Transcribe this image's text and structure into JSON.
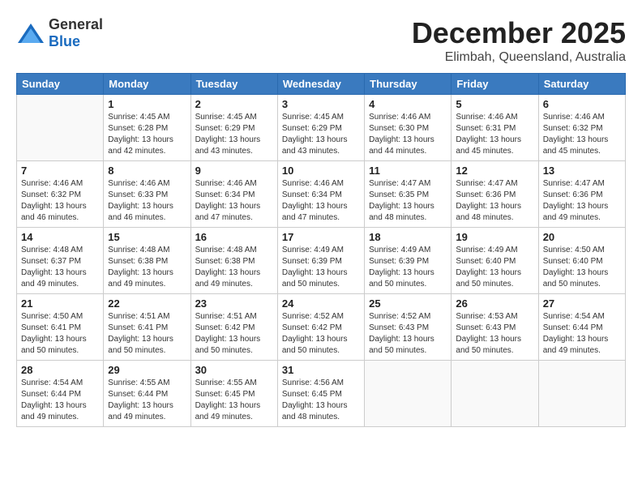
{
  "logo": {
    "general": "General",
    "blue": "Blue"
  },
  "title": "December 2025",
  "location": "Elimbah, Queensland, Australia",
  "days_of_week": [
    "Sunday",
    "Monday",
    "Tuesday",
    "Wednesday",
    "Thursday",
    "Friday",
    "Saturday"
  ],
  "weeks": [
    [
      {
        "day": "",
        "info": ""
      },
      {
        "day": "1",
        "info": "Sunrise: 4:45 AM\nSunset: 6:28 PM\nDaylight: 13 hours\nand 42 minutes."
      },
      {
        "day": "2",
        "info": "Sunrise: 4:45 AM\nSunset: 6:29 PM\nDaylight: 13 hours\nand 43 minutes."
      },
      {
        "day": "3",
        "info": "Sunrise: 4:45 AM\nSunset: 6:29 PM\nDaylight: 13 hours\nand 43 minutes."
      },
      {
        "day": "4",
        "info": "Sunrise: 4:46 AM\nSunset: 6:30 PM\nDaylight: 13 hours\nand 44 minutes."
      },
      {
        "day": "5",
        "info": "Sunrise: 4:46 AM\nSunset: 6:31 PM\nDaylight: 13 hours\nand 45 minutes."
      },
      {
        "day": "6",
        "info": "Sunrise: 4:46 AM\nSunset: 6:32 PM\nDaylight: 13 hours\nand 45 minutes."
      }
    ],
    [
      {
        "day": "7",
        "info": "Sunrise: 4:46 AM\nSunset: 6:32 PM\nDaylight: 13 hours\nand 46 minutes."
      },
      {
        "day": "8",
        "info": "Sunrise: 4:46 AM\nSunset: 6:33 PM\nDaylight: 13 hours\nand 46 minutes."
      },
      {
        "day": "9",
        "info": "Sunrise: 4:46 AM\nSunset: 6:34 PM\nDaylight: 13 hours\nand 47 minutes."
      },
      {
        "day": "10",
        "info": "Sunrise: 4:46 AM\nSunset: 6:34 PM\nDaylight: 13 hours\nand 47 minutes."
      },
      {
        "day": "11",
        "info": "Sunrise: 4:47 AM\nSunset: 6:35 PM\nDaylight: 13 hours\nand 48 minutes."
      },
      {
        "day": "12",
        "info": "Sunrise: 4:47 AM\nSunset: 6:36 PM\nDaylight: 13 hours\nand 48 minutes."
      },
      {
        "day": "13",
        "info": "Sunrise: 4:47 AM\nSunset: 6:36 PM\nDaylight: 13 hours\nand 49 minutes."
      }
    ],
    [
      {
        "day": "14",
        "info": "Sunrise: 4:48 AM\nSunset: 6:37 PM\nDaylight: 13 hours\nand 49 minutes."
      },
      {
        "day": "15",
        "info": "Sunrise: 4:48 AM\nSunset: 6:38 PM\nDaylight: 13 hours\nand 49 minutes."
      },
      {
        "day": "16",
        "info": "Sunrise: 4:48 AM\nSunset: 6:38 PM\nDaylight: 13 hours\nand 49 minutes."
      },
      {
        "day": "17",
        "info": "Sunrise: 4:49 AM\nSunset: 6:39 PM\nDaylight: 13 hours\nand 50 minutes."
      },
      {
        "day": "18",
        "info": "Sunrise: 4:49 AM\nSunset: 6:39 PM\nDaylight: 13 hours\nand 50 minutes."
      },
      {
        "day": "19",
        "info": "Sunrise: 4:49 AM\nSunset: 6:40 PM\nDaylight: 13 hours\nand 50 minutes."
      },
      {
        "day": "20",
        "info": "Sunrise: 4:50 AM\nSunset: 6:40 PM\nDaylight: 13 hours\nand 50 minutes."
      }
    ],
    [
      {
        "day": "21",
        "info": "Sunrise: 4:50 AM\nSunset: 6:41 PM\nDaylight: 13 hours\nand 50 minutes."
      },
      {
        "day": "22",
        "info": "Sunrise: 4:51 AM\nSunset: 6:41 PM\nDaylight: 13 hours\nand 50 minutes."
      },
      {
        "day": "23",
        "info": "Sunrise: 4:51 AM\nSunset: 6:42 PM\nDaylight: 13 hours\nand 50 minutes."
      },
      {
        "day": "24",
        "info": "Sunrise: 4:52 AM\nSunset: 6:42 PM\nDaylight: 13 hours\nand 50 minutes."
      },
      {
        "day": "25",
        "info": "Sunrise: 4:52 AM\nSunset: 6:43 PM\nDaylight: 13 hours\nand 50 minutes."
      },
      {
        "day": "26",
        "info": "Sunrise: 4:53 AM\nSunset: 6:43 PM\nDaylight: 13 hours\nand 50 minutes."
      },
      {
        "day": "27",
        "info": "Sunrise: 4:54 AM\nSunset: 6:44 PM\nDaylight: 13 hours\nand 49 minutes."
      }
    ],
    [
      {
        "day": "28",
        "info": "Sunrise: 4:54 AM\nSunset: 6:44 PM\nDaylight: 13 hours\nand 49 minutes."
      },
      {
        "day": "29",
        "info": "Sunrise: 4:55 AM\nSunset: 6:44 PM\nDaylight: 13 hours\nand 49 minutes."
      },
      {
        "day": "30",
        "info": "Sunrise: 4:55 AM\nSunset: 6:45 PM\nDaylight: 13 hours\nand 49 minutes."
      },
      {
        "day": "31",
        "info": "Sunrise: 4:56 AM\nSunset: 6:45 PM\nDaylight: 13 hours\nand 48 minutes."
      },
      {
        "day": "",
        "info": ""
      },
      {
        "day": "",
        "info": ""
      },
      {
        "day": "",
        "info": ""
      }
    ]
  ]
}
